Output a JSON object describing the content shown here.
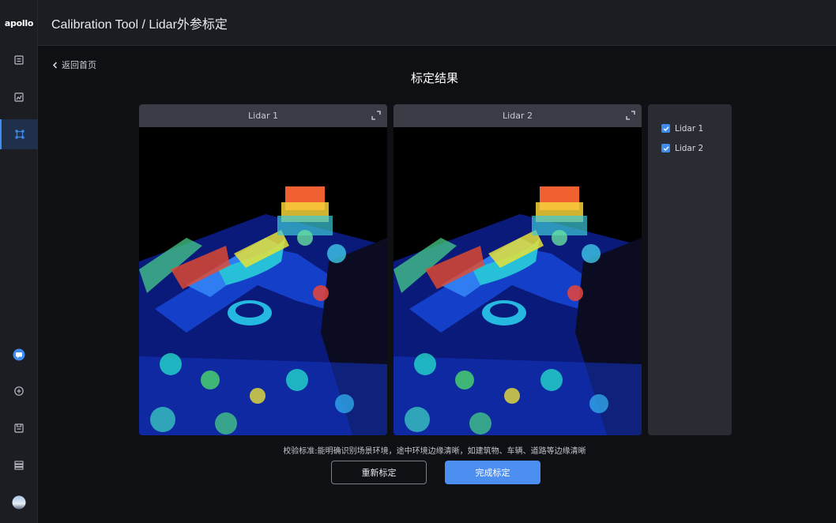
{
  "app": {
    "logo": "apollo",
    "title": "Calibration Tool / Lidar外参标定"
  },
  "sidebar": {
    "items": [
      {
        "name": "records-icon"
      },
      {
        "name": "map-icon"
      },
      {
        "name": "calibration-icon",
        "active": true
      },
      {
        "name": "chat-icon"
      },
      {
        "name": "add-icon"
      },
      {
        "name": "save-icon"
      },
      {
        "name": "list-icon"
      },
      {
        "name": "avatar"
      }
    ]
  },
  "nav": {
    "back_label": "返回首页"
  },
  "main": {
    "title": "标定结果",
    "panels": [
      {
        "label": "Lidar 1"
      },
      {
        "label": "Lidar 2"
      }
    ],
    "legend": [
      {
        "label": "Lidar 1",
        "checked": true
      },
      {
        "label": "Lidar 2",
        "checked": true
      }
    ],
    "hint": "校验标准:能明确识别场景环境，途中环境边缘清晰，如建筑物、车辆、道路等边缘清晰",
    "buttons": {
      "recalibrate": "重新标定",
      "finish": "完成标定"
    }
  },
  "colors": {
    "accent": "#4d8ff0",
    "background": "#0f1014",
    "sidebar": "#1b1d23",
    "panel_header": "#3a3c45"
  }
}
